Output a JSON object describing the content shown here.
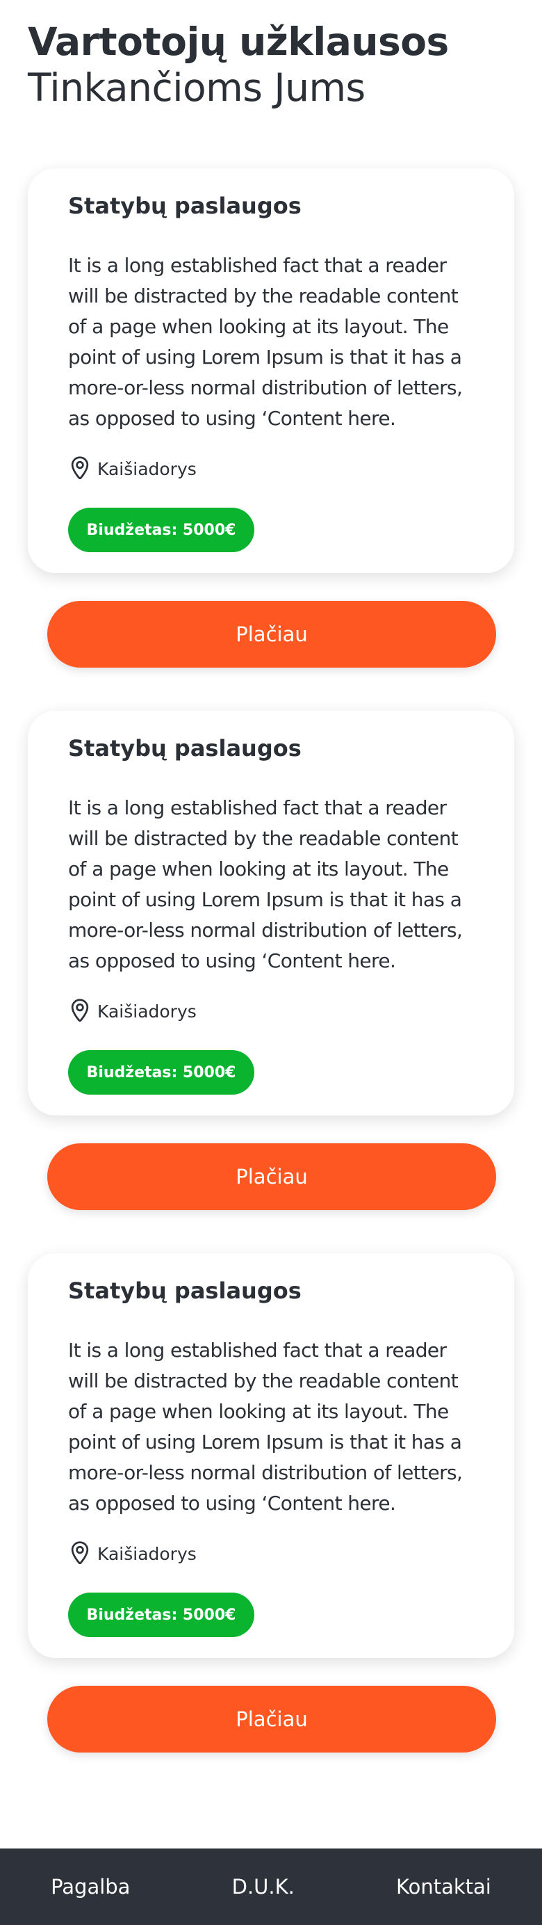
{
  "header": {
    "title": "Vartotojų užklausos",
    "subtitle": "Tinkančioms Jums"
  },
  "requests": [
    {
      "title": "Statybų paslaugos",
      "lines": [
        "It is a long established fact that a reader",
        "will be distracted by the readable content",
        "of a page when looking at its layout. The",
        "point of using Lorem Ipsum is that it has a",
        "more-or-less normal distribution of letters,",
        "as opposed to using ‘Content here."
      ],
      "location": "Kaišiadorys",
      "budget": "Biudžetas: 5000€",
      "button": "Plačiau"
    },
    {
      "title": "Statybų paslaugos",
      "lines": [
        "It is a long established fact that a reader",
        "will be distracted by the readable content",
        "of a page when looking at its layout. The",
        "point of using Lorem Ipsum is that it has a",
        "more-or-less normal distribution of letters,",
        "as opposed to using ‘Content here."
      ],
      "location": "Kaišiadorys",
      "budget": "Biudžetas: 5000€",
      "button": "Plačiau"
    },
    {
      "title": "Statybų paslaugos",
      "lines": [
        "It is a long established fact that a reader",
        "will be distracted by the readable content",
        "of a page when looking at its layout. The",
        "point of using Lorem Ipsum is that it has a",
        "more-or-less normal distribution of letters,",
        "as opposed to using ‘Content here."
      ],
      "location": "Kaišiadorys",
      "budget": "Biudžetas: 5000€",
      "button": "Plačiau"
    }
  ],
  "footer": {
    "links": [
      "Pagalba",
      "D.U.K.",
      "Kontaktai"
    ]
  },
  "colors": {
    "accent": "#ff5722",
    "budget_badge": "#0bb42f",
    "text": "#2b2f36",
    "footer_bg": "#2e323a"
  },
  "icons": {
    "location": "map-pin-icon"
  }
}
